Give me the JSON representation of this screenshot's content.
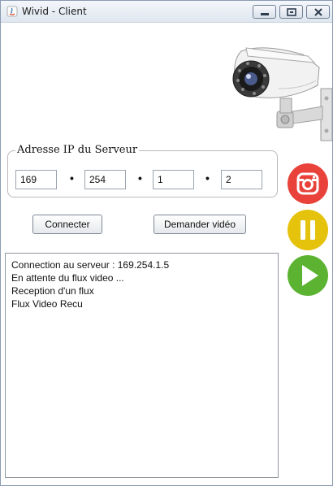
{
  "window": {
    "title": "Wivid - Client"
  },
  "ip_group": {
    "legend": "Adresse IP du Serveur",
    "octets": [
      "169",
      "254",
      "1",
      "2"
    ],
    "separator": "•"
  },
  "buttons": {
    "connect_label": "Connecter",
    "video_label": "Demander vidéo"
  },
  "log": {
    "lines": [
      "Connection au serveur : 169.254.1.5",
      "En attente du flux video ...",
      "Reception d'un flux",
      "Flux Video Recu"
    ]
  },
  "side_controls": {
    "record": {
      "icon": "camera-record-icon",
      "color": "#e9423b"
    },
    "pause": {
      "icon": "pause-icon",
      "color": "#e5c20b"
    },
    "play": {
      "icon": "play-icon",
      "color": "#5bb331"
    }
  }
}
